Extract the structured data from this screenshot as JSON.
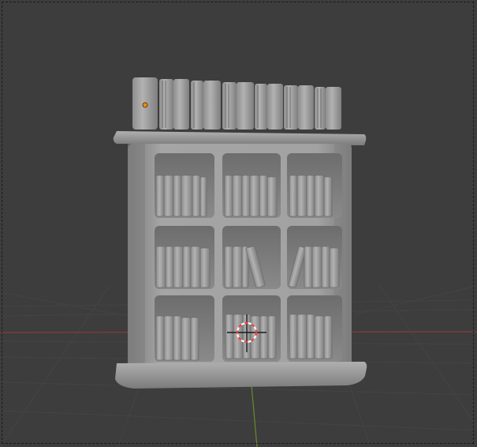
{
  "viewport": {
    "mode": "3D Viewport",
    "shading": "solid",
    "background_color": "#3d3d3d",
    "grid_color": "#454545",
    "x_axis_color": "#8a3a44",
    "y_axis_color": "#6a8a2a"
  },
  "scene_object": {
    "type": "bookcase",
    "mesh_color": "#9a9a9a",
    "origin_color": "#ff8a00",
    "shelves": 9
  },
  "cursor": {
    "color_a": "#ff3b3b",
    "color_b": "#ffffff"
  }
}
